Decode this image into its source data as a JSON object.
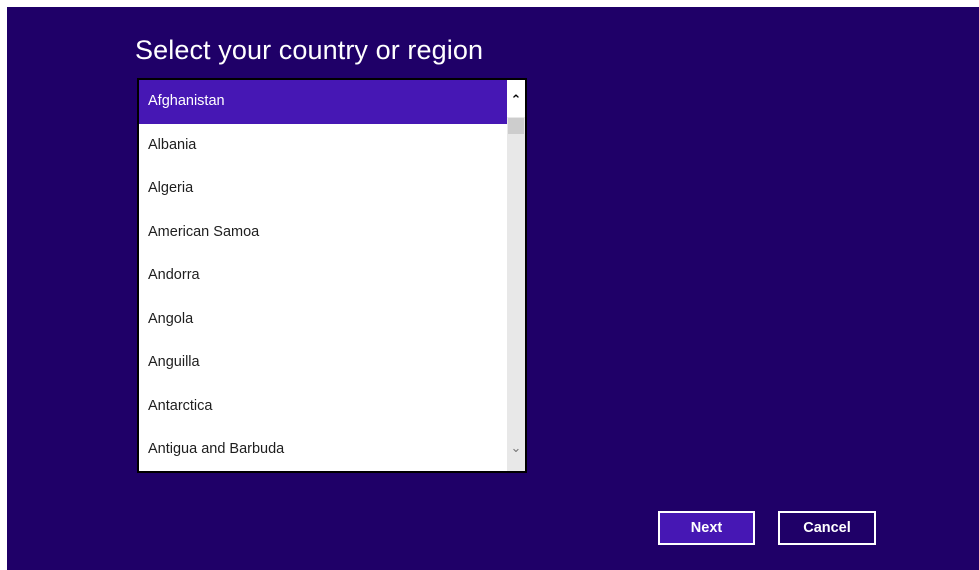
{
  "page": {
    "title": "Select your country or region"
  },
  "country_list": {
    "selected": "Afghanistan",
    "items": [
      {
        "label": "Afghanistan"
      },
      {
        "label": "Albania"
      },
      {
        "label": "Algeria"
      },
      {
        "label": "American Samoa"
      },
      {
        "label": "Andorra"
      },
      {
        "label": "Angola"
      },
      {
        "label": "Anguilla"
      },
      {
        "label": "Antarctica"
      },
      {
        "label": "Antigua and Barbuda"
      }
    ],
    "scroll_up_glyph": "⌃",
    "scroll_down_glyph": "⌄"
  },
  "buttons": {
    "next_label": "Next",
    "cancel_label": "Cancel"
  },
  "colors": {
    "background": "#1f0068",
    "accent": "#4617b4",
    "text_light": "#ffffff"
  },
  "icons": {
    "scroll_up": "chevron-up-icon",
    "scroll_down": "chevron-down-icon"
  }
}
